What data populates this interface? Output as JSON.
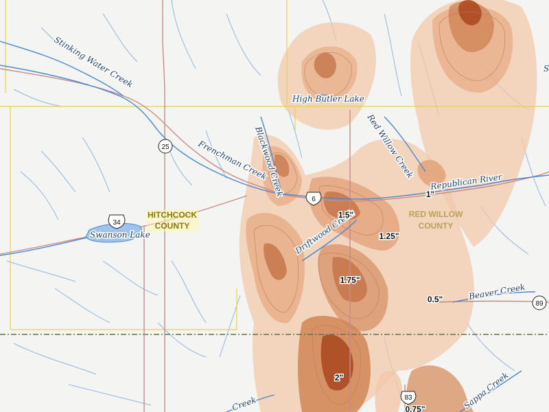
{
  "colors": {
    "background": "#f4f4f2",
    "water": "#4a86d4",
    "lake_fill": "#9ec3ec",
    "highway": "#c98a84",
    "state_line": "#6b6b4e",
    "county_line": "#e6d246",
    "precip_light": "#f2c7a8",
    "precip_mid": "#d99a72",
    "precip_dark": "#b2542a"
  },
  "counties": [
    {
      "name": "HITCHCOCK\nCOUNTY",
      "line1": "HITCHCOCK",
      "line2": "COUNTY",
      "color": "#8a7a00"
    },
    {
      "name": "RED WILLOW\nCOUNTY",
      "line1": "RED WILLOW",
      "line2": "COUNTY",
      "color": "#b7a25a"
    }
  ],
  "water_labels": {
    "stinking_water_creek": "Stinking Water Creek",
    "frenchman_creek": "Frenchman Creek",
    "swanson_lake": "Swanson Lake",
    "high_butler_lake": "High Butler Lake",
    "red_willow_creek": "Red Willow Creek",
    "republican_river": "Republican River",
    "blackwood_creek": "Blackwood Creek",
    "driftwood_creek": "Driftwood Creek",
    "beaver_creek": "Beaver Creek",
    "sappa_creek": "Sappa Creek",
    "lower_left_creek": "Creek",
    "edge_fragment": "S"
  },
  "highway_shields": {
    "us_34": "34",
    "hwy_25": "25",
    "us_6": "6",
    "hwy_89": "89",
    "us_83": "83"
  },
  "precip_labels": {
    "p_1_5": "1.5\"",
    "p_1_25": "1.25\"",
    "p_1": "1\"",
    "p_1_75": "1.75\"",
    "p_0_5": "0.5\"",
    "p_2": "2\"",
    "p_0_75": "0.75\""
  }
}
